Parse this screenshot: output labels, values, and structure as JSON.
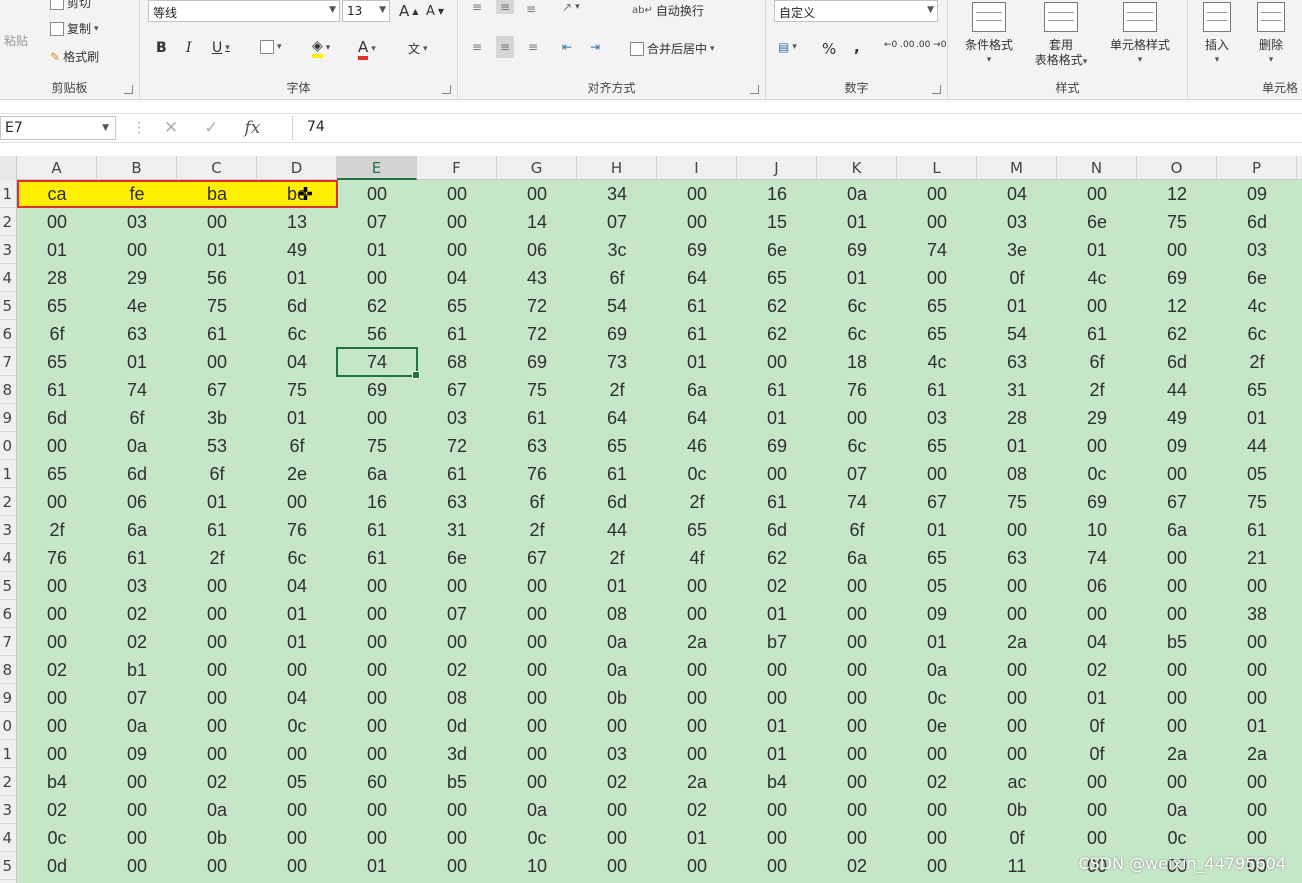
{
  "ribbon": {
    "clipboard": {
      "paste": "粘贴",
      "cut": "剪切",
      "copy": "复制",
      "format_painter": "格式刷",
      "label": "剪贴板"
    },
    "font": {
      "name": "等线",
      "size": "13",
      "grow": "A",
      "shrink": "A",
      "bold": "B",
      "italic": "I",
      "underline": "U",
      "font_color": "A",
      "phonetic": "文",
      "label": "字体"
    },
    "alignment": {
      "wrap_text": "自动换行",
      "merge_center": "合并后居中",
      "label": "对齐方式"
    },
    "number": {
      "format": "自定义",
      "percent": "%",
      "comma": ",",
      "inc_decimal": "←0 .00",
      "dec_decimal": ".00 →0",
      "label": "数字"
    },
    "styles": {
      "conditional": "条件格式",
      "table_line1": "套用",
      "table_line2": "表格格式",
      "cell_styles": "单元格样式",
      "label": "样式"
    },
    "cells": {
      "insert": "插入",
      "delete": "删除",
      "label": "单元格"
    }
  },
  "formula_bar": {
    "name_box": "E7",
    "fx": "fx",
    "value": "74"
  },
  "sheet": {
    "columns": [
      "A",
      "B",
      "C",
      "D",
      "E",
      "F",
      "G",
      "H",
      "I",
      "J",
      "K",
      "L",
      "M",
      "N",
      "O",
      "P"
    ],
    "row_labels": [
      "1",
      "2",
      "3",
      "4",
      "5",
      "6",
      "7",
      "8",
      "9",
      "0",
      "1",
      "2",
      "3",
      "4",
      "5",
      "6",
      "7",
      "8",
      "9",
      "0",
      "1",
      "2",
      "3",
      "4",
      "5"
    ],
    "active_column": "E",
    "active_cell": "E7",
    "rows": [
      [
        "ca",
        "fe",
        "ba",
        "be",
        "00",
        "00",
        "00",
        "34",
        "00",
        "16",
        "0a",
        "00",
        "04",
        "00",
        "12",
        "09"
      ],
      [
        "00",
        "03",
        "00",
        "13",
        "07",
        "00",
        "14",
        "07",
        "00",
        "15",
        "01",
        "00",
        "03",
        "6e",
        "75",
        "6d"
      ],
      [
        "01",
        "00",
        "01",
        "49",
        "01",
        "00",
        "06",
        "3c",
        "69",
        "6e",
        "69",
        "74",
        "3e",
        "01",
        "00",
        "03"
      ],
      [
        "28",
        "29",
        "56",
        "01",
        "00",
        "04",
        "43",
        "6f",
        "64",
        "65",
        "01",
        "00",
        "0f",
        "4c",
        "69",
        "6e"
      ],
      [
        "65",
        "4e",
        "75",
        "6d",
        "62",
        "65",
        "72",
        "54",
        "61",
        "62",
        "6c",
        "65",
        "01",
        "00",
        "12",
        "4c"
      ],
      [
        "6f",
        "63",
        "61",
        "6c",
        "56",
        "61",
        "72",
        "69",
        "61",
        "62",
        "6c",
        "65",
        "54",
        "61",
        "62",
        "6c"
      ],
      [
        "65",
        "01",
        "00",
        "04",
        "74",
        "68",
        "69",
        "73",
        "01",
        "00",
        "18",
        "4c",
        "63",
        "6f",
        "6d",
        "2f"
      ],
      [
        "61",
        "74",
        "67",
        "75",
        "69",
        "67",
        "75",
        "2f",
        "6a",
        "61",
        "76",
        "61",
        "31",
        "2f",
        "44",
        "65"
      ],
      [
        "6d",
        "6f",
        "3b",
        "01",
        "00",
        "03",
        "61",
        "64",
        "64",
        "01",
        "00",
        "03",
        "28",
        "29",
        "49",
        "01"
      ],
      [
        "00",
        "0a",
        "53",
        "6f",
        "75",
        "72",
        "63",
        "65",
        "46",
        "69",
        "6c",
        "65",
        "01",
        "00",
        "09",
        "44"
      ],
      [
        "65",
        "6d",
        "6f",
        "2e",
        "6a",
        "61",
        "76",
        "61",
        "0c",
        "00",
        "07",
        "00",
        "08",
        "0c",
        "00",
        "05"
      ],
      [
        "00",
        "06",
        "01",
        "00",
        "16",
        "63",
        "6f",
        "6d",
        "2f",
        "61",
        "74",
        "67",
        "75",
        "69",
        "67",
        "75"
      ],
      [
        "2f",
        "6a",
        "61",
        "76",
        "61",
        "31",
        "2f",
        "44",
        "65",
        "6d",
        "6f",
        "01",
        "00",
        "10",
        "6a",
        "61"
      ],
      [
        "76",
        "61",
        "2f",
        "6c",
        "61",
        "6e",
        "67",
        "2f",
        "4f",
        "62",
        "6a",
        "65",
        "63",
        "74",
        "00",
        "21"
      ],
      [
        "00",
        "03",
        "00",
        "04",
        "00",
        "00",
        "00",
        "01",
        "00",
        "02",
        "00",
        "05",
        "00",
        "06",
        "00",
        "00"
      ],
      [
        "00",
        "02",
        "00",
        "01",
        "00",
        "07",
        "00",
        "08",
        "00",
        "01",
        "00",
        "09",
        "00",
        "00",
        "00",
        "38"
      ],
      [
        "00",
        "02",
        "00",
        "01",
        "00",
        "00",
        "00",
        "0a",
        "2a",
        "b7",
        "00",
        "01",
        "2a",
        "04",
        "b5",
        "00"
      ],
      [
        "02",
        "b1",
        "00",
        "00",
        "00",
        "02",
        "00",
        "0a",
        "00",
        "00",
        "00",
        "0a",
        "00",
        "02",
        "00",
        "00"
      ],
      [
        "00",
        "07",
        "00",
        "04",
        "00",
        "08",
        "00",
        "0b",
        "00",
        "00",
        "00",
        "0c",
        "00",
        "01",
        "00",
        "00"
      ],
      [
        "00",
        "0a",
        "00",
        "0c",
        "00",
        "0d",
        "00",
        "00",
        "00",
        "01",
        "00",
        "0e",
        "00",
        "0f",
        "00",
        "01"
      ],
      [
        "00",
        "09",
        "00",
        "00",
        "00",
        "3d",
        "00",
        "03",
        "00",
        "01",
        "00",
        "00",
        "00",
        "0f",
        "2a",
        "2a"
      ],
      [
        "b4",
        "00",
        "02",
        "05",
        "60",
        "b5",
        "00",
        "02",
        "2a",
        "b4",
        "00",
        "02",
        "ac",
        "00",
        "00",
        "00"
      ],
      [
        "02",
        "00",
        "0a",
        "00",
        "00",
        "00",
        "0a",
        "00",
        "02",
        "00",
        "00",
        "00",
        "0b",
        "00",
        "0a",
        "00"
      ],
      [
        "0c",
        "00",
        "0b",
        "00",
        "00",
        "00",
        "0c",
        "00",
        "01",
        "00",
        "00",
        "00",
        "0f",
        "00",
        "0c",
        "00"
      ],
      [
        "0d",
        "00",
        "00",
        "00",
        "01",
        "00",
        "10",
        "00",
        "00",
        "00",
        "02",
        "00",
        "11",
        "00",
        "00",
        "00"
      ]
    ]
  },
  "watermark": "CSDN @weixin_44795604",
  "colors": {
    "sheet_fill": "#c6e6c8",
    "highlight_fill": "#ffef00",
    "highlight_border": "#e0312b",
    "active_border": "#217346"
  }
}
